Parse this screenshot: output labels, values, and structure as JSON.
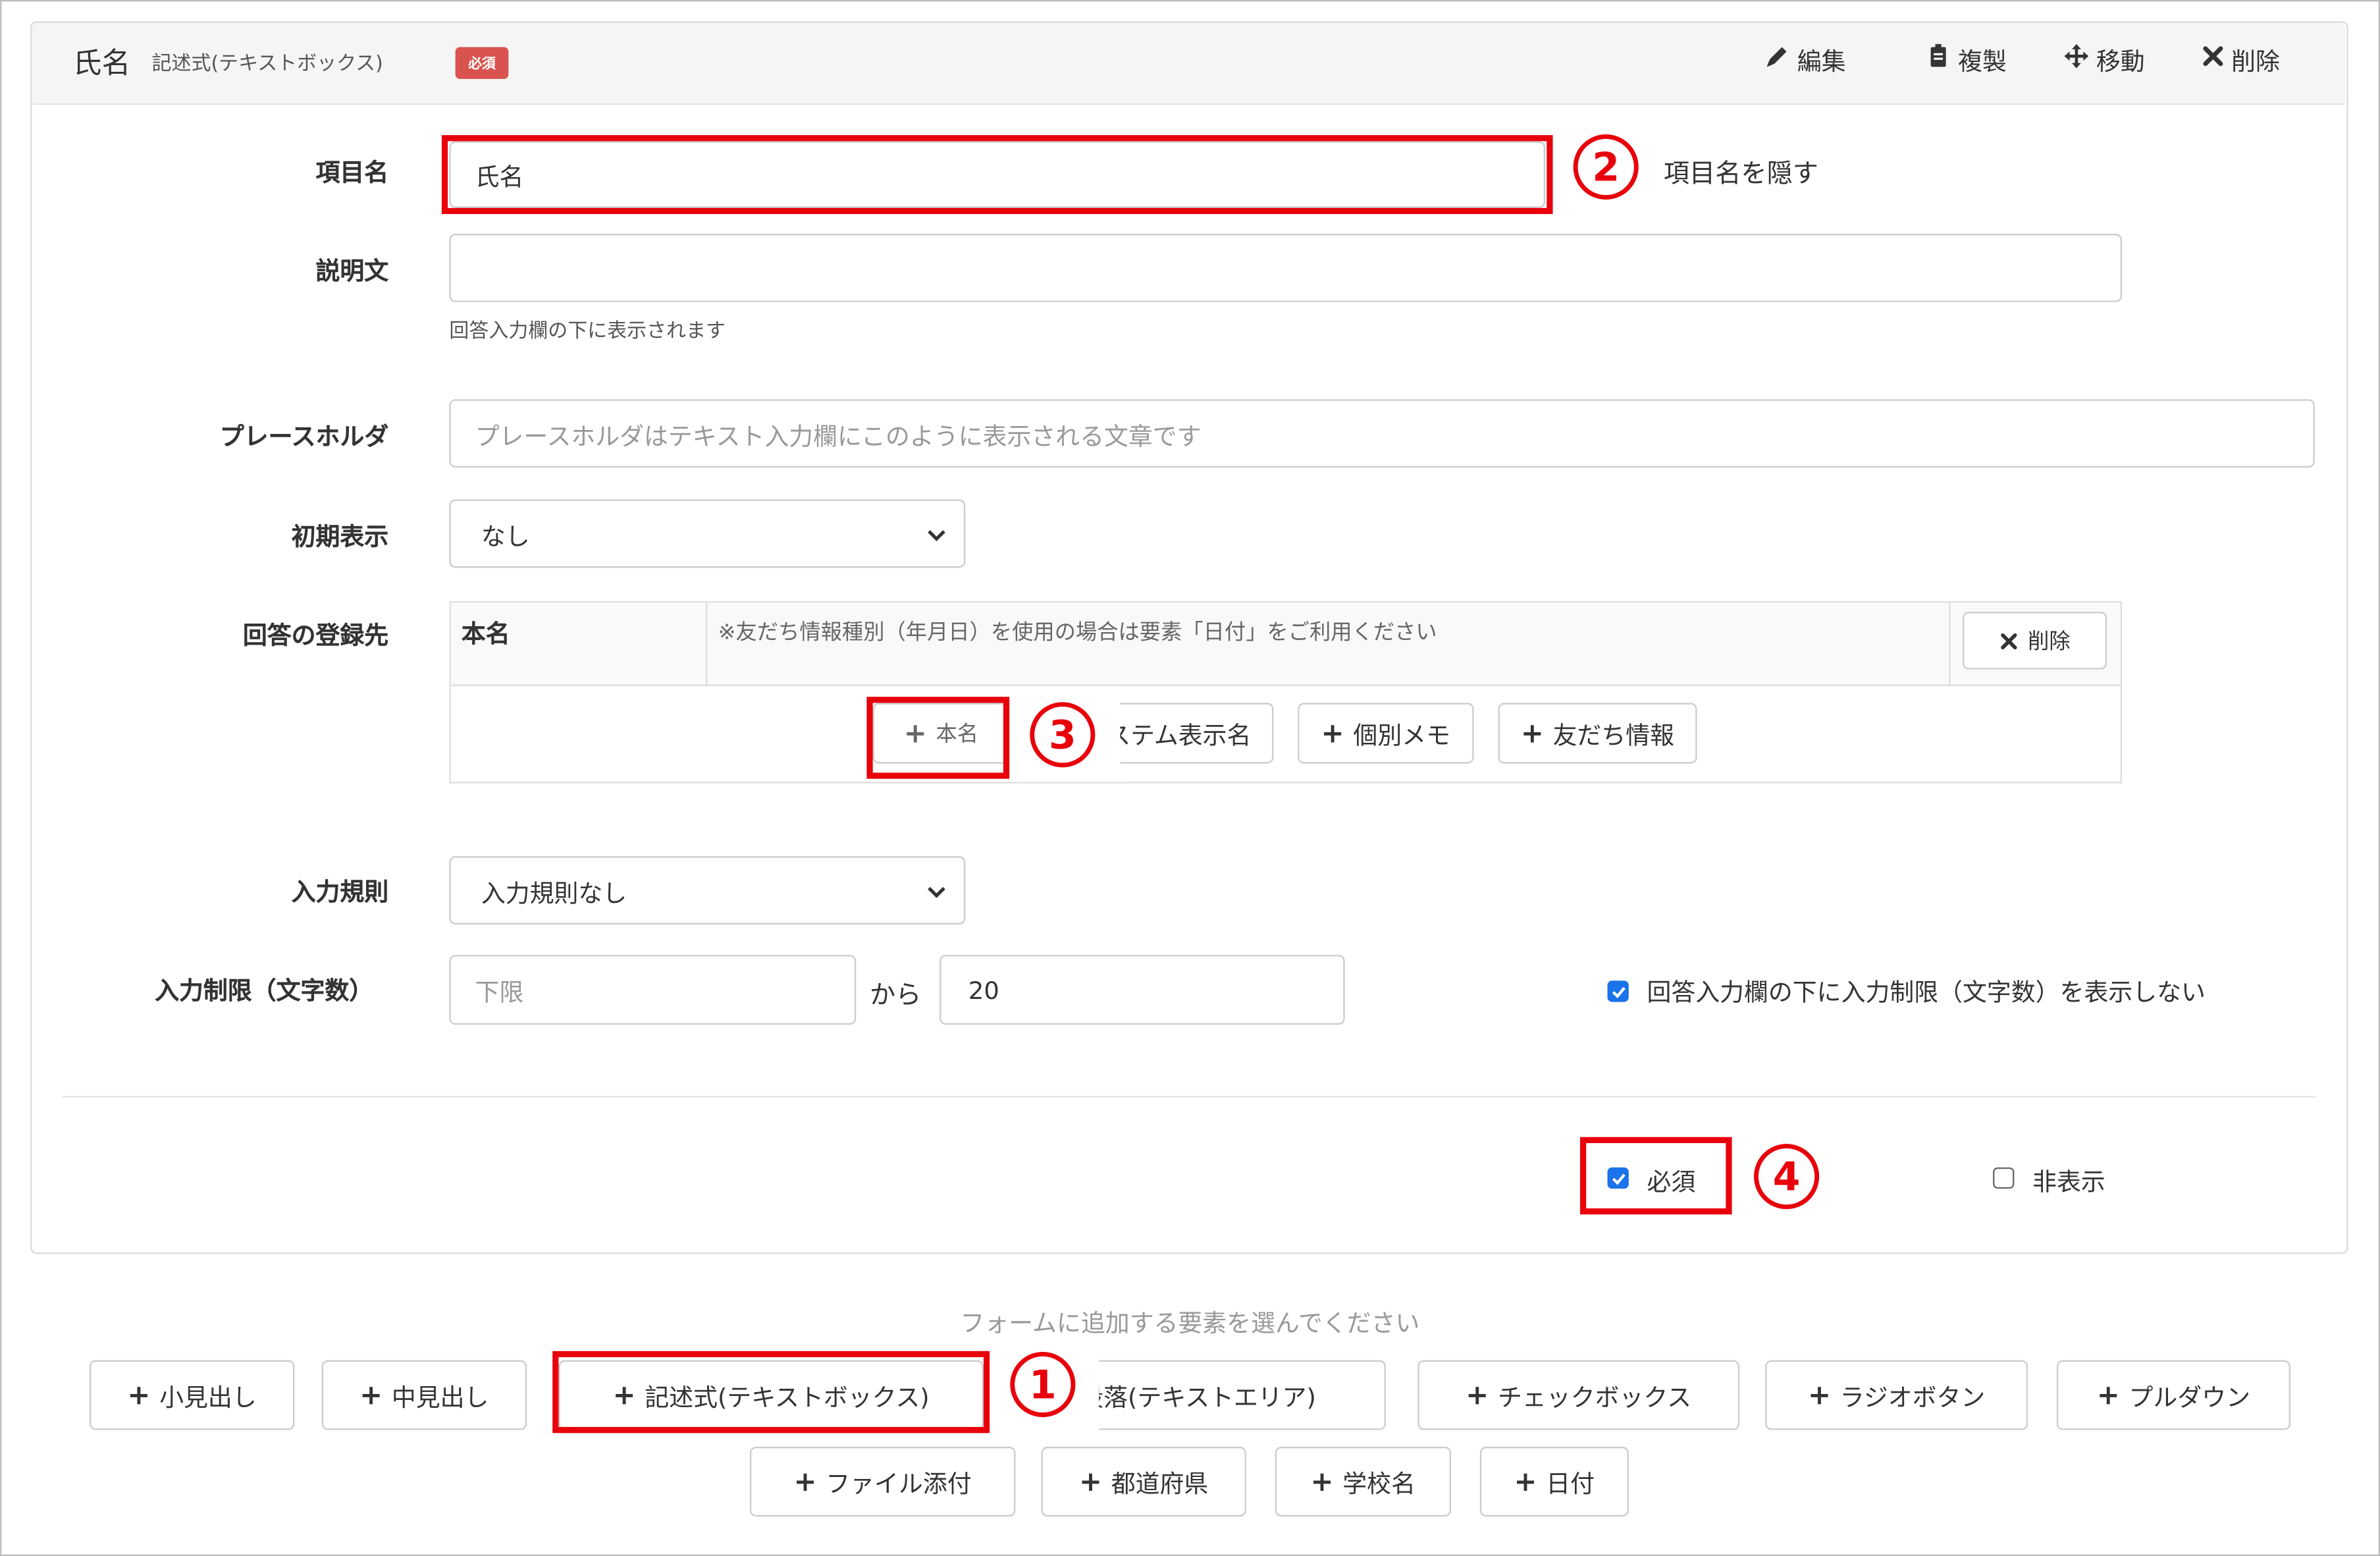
{
  "header": {
    "field_title": "氏名",
    "field_type": "記述式(テキストボックス)",
    "required_badge": "必須",
    "actions": {
      "edit": "編集",
      "duplicate": "複製",
      "move": "移動",
      "delete": "削除"
    }
  },
  "form": {
    "item_name": {
      "label": "項目名",
      "value": "氏名",
      "hide_label_text": "項目名を隠す"
    },
    "description": {
      "label": "説明文",
      "value": "",
      "help": "回答入力欄の下に表示されます"
    },
    "placeholder": {
      "label": "プレースホルダ",
      "placeholder": "プレースホルダはテキスト入力欄にこのように表示される文章です"
    },
    "initial_display": {
      "label": "初期表示",
      "selected": "なし"
    },
    "registration": {
      "label": "回答の登録先",
      "row_name": "本名",
      "row_note": "※友だち情報種別（年月日）を使用の場合は要素「日付」をご利用ください",
      "row_delete": "削除",
      "add_buttons": [
        "本名",
        "システム表示名",
        "個別メモ",
        "友だち情報"
      ]
    },
    "input_rule": {
      "label": "入力規則",
      "selected": "入力規則なし"
    },
    "char_limit": {
      "label": "入力制限（文字数）",
      "min_placeholder": "下限",
      "from_text": "から",
      "max_value": "20",
      "hide_limit_text": "回答入力欄の下に入力制限（文字数）を表示しない",
      "hide_limit_checked": true
    },
    "required": {
      "label": "必須",
      "checked": true
    },
    "hidden": {
      "label": "非表示",
      "checked": false
    }
  },
  "add_elements": {
    "prompt": "フォームに追加する要素を選んでください",
    "row1": [
      "小見出し",
      "中見出し",
      "記述式(テキストボックス)",
      "段落(テキストエリア)",
      "チェックボックス",
      "ラジオボタン",
      "プルダウン"
    ],
    "row2": [
      "ファイル添付",
      "都道府県",
      "学校名",
      "日付"
    ]
  },
  "annotations": {
    "n1": "1",
    "n2": "2",
    "n3": "3",
    "n4": "4"
  },
  "colors": {
    "accent_red": "#e8000b",
    "badge_red": "#d9534f",
    "checkbox_blue": "#1a73e8"
  }
}
